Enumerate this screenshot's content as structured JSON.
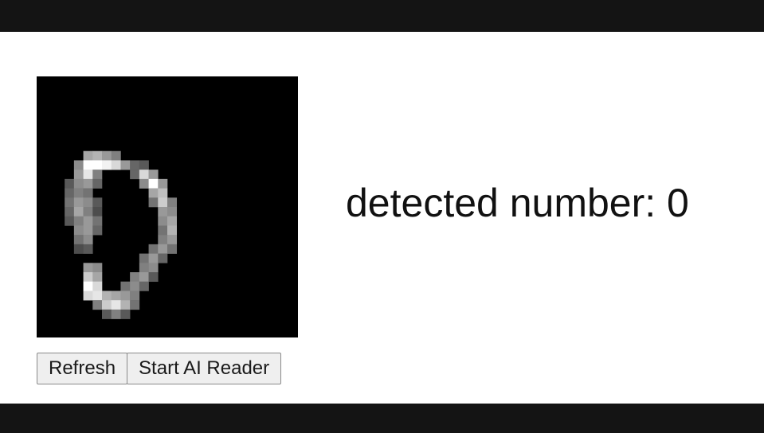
{
  "buttons": {
    "refresh_label": "Refresh",
    "start_label": "Start AI Reader"
  },
  "result": {
    "label": "detected number:",
    "value": "0"
  },
  "colors": {
    "frame": "#141414",
    "page": "#ffffff",
    "canvas": "#000000"
  },
  "digit_image": {
    "grid": 28,
    "pixels": [
      [
        5,
        8,
        0.65
      ],
      [
        6,
        8,
        0.7
      ],
      [
        7,
        8,
        0.6
      ],
      [
        8,
        8,
        0.5
      ],
      [
        4,
        9,
        0.55
      ],
      [
        5,
        9,
        1.0
      ],
      [
        6,
        9,
        1.0
      ],
      [
        7,
        9,
        0.95
      ],
      [
        8,
        9,
        0.85
      ],
      [
        9,
        9,
        0.6
      ],
      [
        10,
        9,
        0.4
      ],
      [
        11,
        9,
        0.35
      ],
      [
        4,
        10,
        0.6
      ],
      [
        5,
        10,
        0.9
      ],
      [
        6,
        10,
        0.5
      ],
      [
        10,
        10,
        0.4
      ],
      [
        11,
        10,
        0.85
      ],
      [
        12,
        10,
        0.6
      ],
      [
        3,
        11,
        0.35
      ],
      [
        4,
        11,
        0.55
      ],
      [
        5,
        11,
        0.6
      ],
      [
        6,
        11,
        0.4
      ],
      [
        11,
        11,
        0.55
      ],
      [
        12,
        11,
        1.0
      ],
      [
        13,
        11,
        0.6
      ],
      [
        3,
        12,
        0.4
      ],
      [
        4,
        12,
        0.5
      ],
      [
        5,
        12,
        0.45
      ],
      [
        12,
        12,
        0.65
      ],
      [
        13,
        12,
        0.75
      ],
      [
        3,
        13,
        0.45
      ],
      [
        4,
        13,
        0.6
      ],
      [
        5,
        13,
        0.55
      ],
      [
        6,
        13,
        0.35
      ],
      [
        12,
        13,
        0.45
      ],
      [
        13,
        13,
        0.8
      ],
      [
        14,
        13,
        0.5
      ],
      [
        3,
        14,
        0.4
      ],
      [
        4,
        14,
        0.65
      ],
      [
        5,
        14,
        0.5
      ],
      [
        6,
        14,
        0.3
      ],
      [
        13,
        14,
        0.6
      ],
      [
        14,
        14,
        0.55
      ],
      [
        3,
        15,
        0.35
      ],
      [
        4,
        15,
        0.5
      ],
      [
        5,
        15,
        0.6
      ],
      [
        6,
        15,
        0.45
      ],
      [
        13,
        15,
        0.55
      ],
      [
        14,
        15,
        0.65
      ],
      [
        4,
        16,
        0.55
      ],
      [
        5,
        16,
        0.6
      ],
      [
        6,
        16,
        0.4
      ],
      [
        13,
        16,
        0.45
      ],
      [
        14,
        16,
        0.7
      ],
      [
        4,
        17,
        0.45
      ],
      [
        5,
        17,
        0.55
      ],
      [
        13,
        17,
        0.5
      ],
      [
        14,
        17,
        0.6
      ],
      [
        4,
        18,
        0.3
      ],
      [
        5,
        18,
        0.35
      ],
      [
        12,
        18,
        0.45
      ],
      [
        13,
        18,
        0.6
      ],
      [
        14,
        18,
        0.45
      ],
      [
        11,
        19,
        0.45
      ],
      [
        12,
        19,
        0.6
      ],
      [
        13,
        19,
        0.4
      ],
      [
        5,
        20,
        0.6
      ],
      [
        6,
        20,
        0.55
      ],
      [
        11,
        20,
        0.5
      ],
      [
        12,
        20,
        0.55
      ],
      [
        5,
        21,
        0.8
      ],
      [
        6,
        21,
        0.65
      ],
      [
        10,
        21,
        0.5
      ],
      [
        11,
        21,
        0.6
      ],
      [
        12,
        21,
        0.35
      ],
      [
        5,
        22,
        1.0
      ],
      [
        6,
        22,
        0.85
      ],
      [
        9,
        22,
        0.45
      ],
      [
        10,
        22,
        0.55
      ],
      [
        11,
        22,
        0.4
      ],
      [
        5,
        23,
        0.85
      ],
      [
        6,
        23,
        0.9
      ],
      [
        7,
        23,
        0.7
      ],
      [
        8,
        23,
        0.65
      ],
      [
        9,
        23,
        0.6
      ],
      [
        10,
        23,
        0.5
      ],
      [
        6,
        24,
        0.5
      ],
      [
        7,
        24,
        0.8
      ],
      [
        8,
        24,
        0.9
      ],
      [
        9,
        24,
        0.7
      ],
      [
        10,
        24,
        0.45
      ],
      [
        7,
        25,
        0.35
      ],
      [
        8,
        25,
        0.5
      ],
      [
        9,
        25,
        0.35
      ]
    ]
  }
}
